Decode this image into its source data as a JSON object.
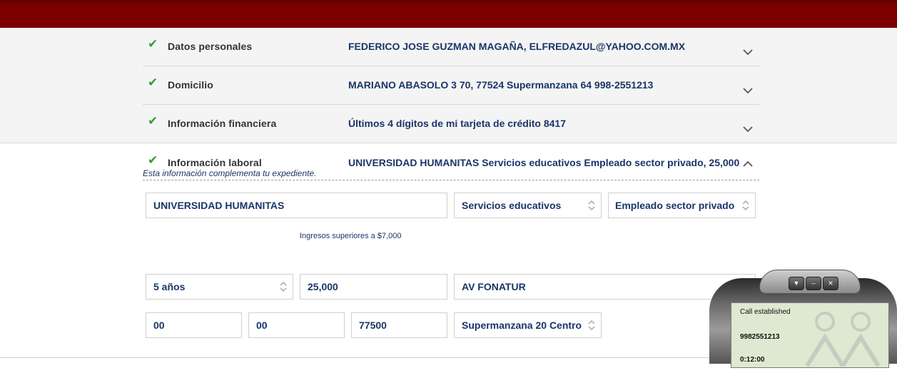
{
  "sections": [
    {
      "label": "Datos personales",
      "value": "FEDERICO JOSE GUZMAN MAGAÑA, ELFREDAZUL@YAHOO.COM.MX"
    },
    {
      "label": "Domicilio",
      "value": "MARIANO ABASOLO 3 70, 77524 Supermanzana 64 998-2551213"
    },
    {
      "label": "Información financiera",
      "value": "Últimos 4 dígitos de mi tarjeta de crédito 8417"
    },
    {
      "label": "Información laboral",
      "value": "UNIVERSIDAD HUMANITAS Servicios educativos Empleado sector privado, 25,000"
    }
  ],
  "laboral": {
    "note": "Esta información complementa tu expediente.",
    "empresa": "UNIVERSIDAD HUMANITAS",
    "giro": "Servicios educativos",
    "tipo_empleo": "Empleado sector privado",
    "ingresos_hint": "Ingresos superiores a $7,000",
    "antiguedad": "5 años",
    "ingresos": "25,000",
    "calle": "AV FONATUR",
    "num_ext": "00",
    "num_int": "00",
    "cp": "77500",
    "colonia": "Supermanzana 20 Centro"
  },
  "phone": {
    "status": "Call established",
    "number": "9982551213",
    "extra": "0:12:00"
  },
  "colors": {
    "header": "#7d0000",
    "check": "#2ea02e",
    "text_value": "#1a3568"
  }
}
